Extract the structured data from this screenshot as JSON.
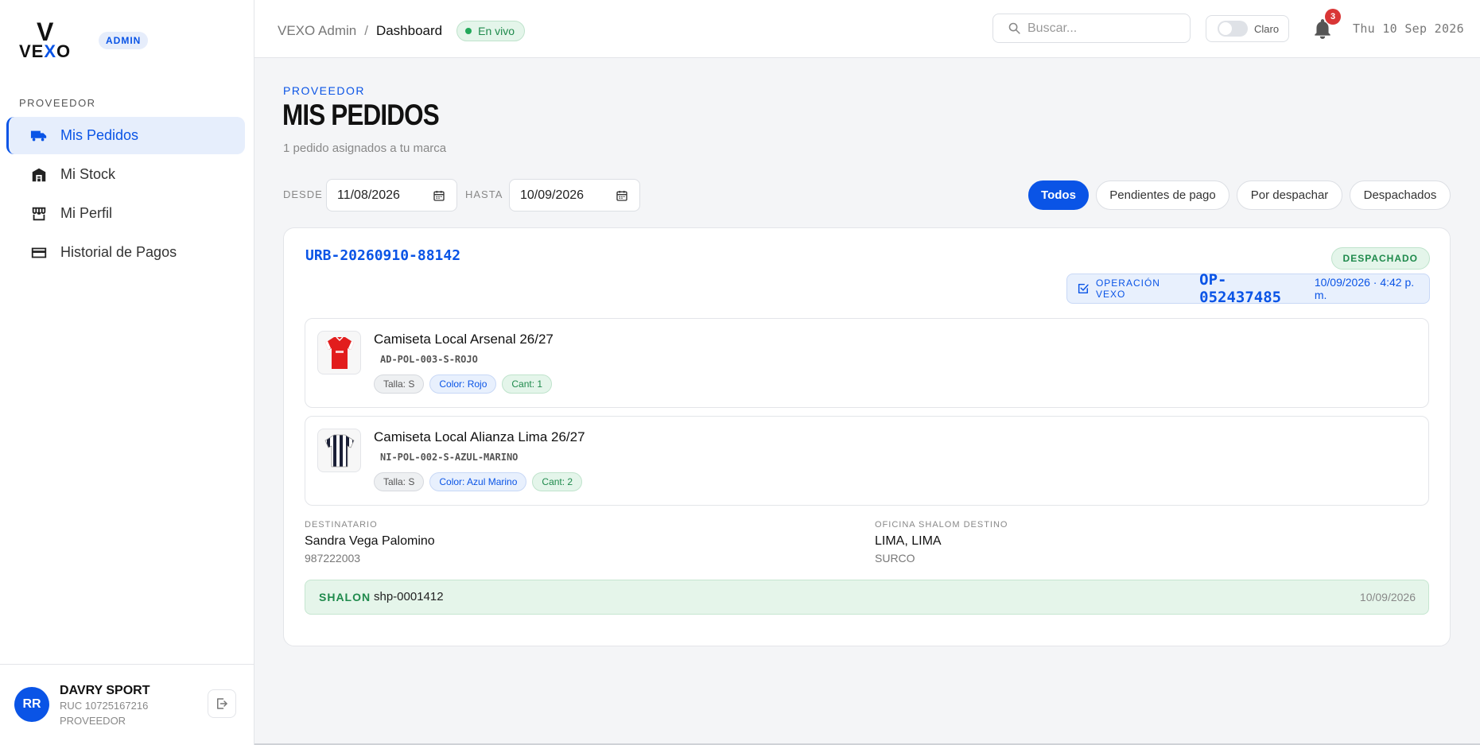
{
  "brand": {
    "logo_mark": "V",
    "logo_word_pre": "VE",
    "logo_word_x": "X",
    "logo_word_post": "O",
    "badge": "ADMIN"
  },
  "sidebar": {
    "section": "PROVEEDOR",
    "items": [
      {
        "label": "Mis Pedidos",
        "icon": "truck-icon",
        "active": true
      },
      {
        "label": "Mi Stock",
        "icon": "warehouse-icon",
        "active": false
      },
      {
        "label": "Mi Perfil",
        "icon": "store-icon",
        "active": false
      },
      {
        "label": "Historial de Pagos",
        "icon": "credit-card-icon",
        "active": false
      }
    ],
    "user": {
      "initials": "RR",
      "name": "DAVRY SPORT",
      "ruc": "RUC 10725167216",
      "role": "PROVEEDOR"
    }
  },
  "header": {
    "breadcrumb_root": "VEXO Admin",
    "breadcrumb_sep": "/",
    "breadcrumb_current": "Dashboard",
    "live_badge": "En vivo",
    "search_placeholder": "Buscar...",
    "theme_label": "Claro",
    "notifications": "3",
    "date": "Thu 10 Sep 2026"
  },
  "page": {
    "eyebrow": "PROVEEDOR",
    "title": "MIS PEDIDOS",
    "subtitle": "1 pedido asignados a tu marca"
  },
  "filters": {
    "from_label": "DESDE",
    "from_value": "11/08/2026",
    "to_label": "HASTA",
    "to_value": "10/09/2026",
    "pills": [
      "Todos",
      "Pendientes de pago",
      "Por despachar",
      "Despachados"
    ],
    "active_pill": "Todos"
  },
  "order": {
    "id": "URB-20260910-88142",
    "status": "DESPACHADO",
    "operation_label": "OPERACIÓN VEXO",
    "operation_code": "OP-052437485",
    "operation_date": "10/09/2026 · 4:42 p. m.",
    "items": [
      {
        "name": "Camiseta Local Arsenal 26/27",
        "sku": "AD-POL-003-S-ROJO",
        "size": "Talla: S",
        "color": "Color: Rojo",
        "qty": "Cant: 1",
        "jersey": "red"
      },
      {
        "name": "Camiseta Local Alianza Lima 26/27",
        "sku": "NI-POL-002-S-AZUL-MARINO",
        "size": "Talla: S",
        "color": "Color: Azul Marino",
        "qty": "Cant: 2",
        "jersey": "striped"
      }
    ],
    "recipient_label": "DESTINATARIO",
    "recipient_name": "Sandra Vega Palomino",
    "recipient_phone": "987222003",
    "office_label": "OFICINA SHALOM DESTINO",
    "office_city": "LIMA, LIMA",
    "office_district": "SURCO",
    "shipping_carrier": "SHALON",
    "shipping_code": "shp-0001412",
    "shipping_date": "10/09/2026"
  },
  "colors": {
    "accent": "#0a54e6",
    "success": "#1f8a4c",
    "danger": "#d93636"
  }
}
